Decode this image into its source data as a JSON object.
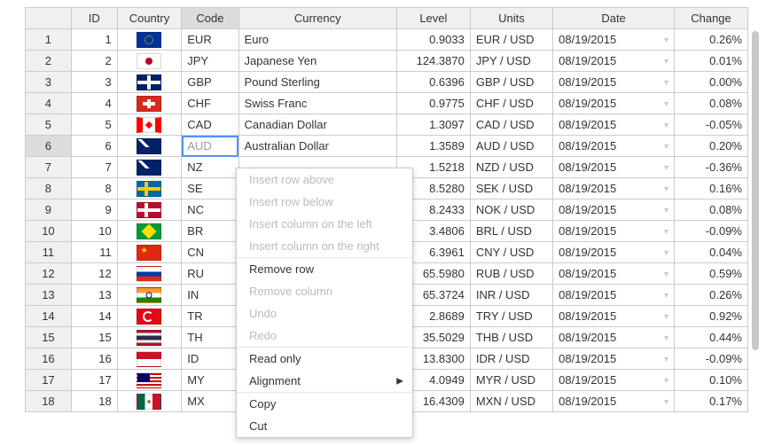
{
  "headers": {
    "id": "ID",
    "country": "Country",
    "code": "Code",
    "currency": "Currency",
    "level": "Level",
    "units": "Units",
    "date": "Date",
    "change": "Change"
  },
  "rows": [
    {
      "n": "1",
      "id": "1",
      "flag": "eu",
      "code": "EUR",
      "currency": "Euro",
      "level": "0.9033",
      "units": "EUR / USD",
      "date": "08/19/2015",
      "change": "0.26%"
    },
    {
      "n": "2",
      "id": "2",
      "flag": "jp",
      "code": "JPY",
      "currency": "Japanese Yen",
      "level": "124.3870",
      "units": "JPY / USD",
      "date": "08/19/2015",
      "change": "0.01%"
    },
    {
      "n": "3",
      "id": "3",
      "flag": "gb",
      "code": "GBP",
      "currency": "Pound Sterling",
      "level": "0.6396",
      "units": "GBP / USD",
      "date": "08/19/2015",
      "change": "0.00%"
    },
    {
      "n": "4",
      "id": "4",
      "flag": "ch",
      "code": "CHF",
      "currency": "Swiss Franc",
      "level": "0.9775",
      "units": "CHF / USD",
      "date": "08/19/2015",
      "change": "0.08%"
    },
    {
      "n": "5",
      "id": "5",
      "flag": "ca",
      "code": "CAD",
      "currency": "Canadian Dollar",
      "level": "1.3097",
      "units": "CAD / USD",
      "date": "08/19/2015",
      "change": "-0.05%"
    },
    {
      "n": "6",
      "id": "6",
      "flag": "au",
      "code": "AUD",
      "currency": "Australian Dollar",
      "level": "1.3589",
      "units": "AUD / USD",
      "date": "08/19/2015",
      "change": "0.20%"
    },
    {
      "n": "7",
      "id": "7",
      "flag": "nz",
      "code": "NZ",
      "currency": "",
      "level": "1.5218",
      "units": "NZD / USD",
      "date": "08/19/2015",
      "change": "-0.36%"
    },
    {
      "n": "8",
      "id": "8",
      "flag": "se",
      "code": "SE",
      "currency": "",
      "level": "8.5280",
      "units": "SEK / USD",
      "date": "08/19/2015",
      "change": "0.16%"
    },
    {
      "n": "9",
      "id": "9",
      "flag": "no",
      "code": "NC",
      "currency": "",
      "level": "8.2433",
      "units": "NOK / USD",
      "date": "08/19/2015",
      "change": "0.08%"
    },
    {
      "n": "10",
      "id": "10",
      "flag": "br",
      "code": "BR",
      "currency": "",
      "level": "3.4806",
      "units": "BRL / USD",
      "date": "08/19/2015",
      "change": "-0.09%"
    },
    {
      "n": "11",
      "id": "11",
      "flag": "cn",
      "code": "CN",
      "currency": "",
      "level": "6.3961",
      "units": "CNY / USD",
      "date": "08/19/2015",
      "change": "0.04%"
    },
    {
      "n": "12",
      "id": "12",
      "flag": "ru",
      "code": "RU",
      "currency": "",
      "level": "65.5980",
      "units": "RUB / USD",
      "date": "08/19/2015",
      "change": "0.59%"
    },
    {
      "n": "13",
      "id": "13",
      "flag": "in",
      "code": "IN",
      "currency": "",
      "level": "65.3724",
      "units": "INR / USD",
      "date": "08/19/2015",
      "change": "0.26%"
    },
    {
      "n": "14",
      "id": "14",
      "flag": "tr",
      "code": "TR",
      "currency": "",
      "level": "2.8689",
      "units": "TRY / USD",
      "date": "08/19/2015",
      "change": "0.92%"
    },
    {
      "n": "15",
      "id": "15",
      "flag": "th",
      "code": "TH",
      "currency": "",
      "level": "35.5029",
      "units": "THB / USD",
      "date": "08/19/2015",
      "change": "0.44%"
    },
    {
      "n": "16",
      "id": "16",
      "flag": "id",
      "code": "ID",
      "currency": "",
      "level": "13.8300",
      "units": "IDR / USD",
      "date": "08/19/2015",
      "change": "-0.09%"
    },
    {
      "n": "17",
      "id": "17",
      "flag": "my",
      "code": "MY",
      "currency": "",
      "level": "4.0949",
      "units": "MYR / USD",
      "date": "08/19/2015",
      "change": "0.10%"
    },
    {
      "n": "18",
      "id": "18",
      "flag": "mx",
      "code": "MX",
      "currency": "",
      "level": "16.4309",
      "units": "MXN / USD",
      "date": "08/19/2015",
      "change": "0.17%"
    }
  ],
  "active_row_index": 5,
  "context_menu": {
    "items": [
      {
        "label": "Insert row above",
        "disabled": true
      },
      {
        "label": "Insert row below",
        "disabled": true
      },
      {
        "label": "Insert column on the left",
        "disabled": true
      },
      {
        "label": "Insert column on the right",
        "disabled": true
      }
    ],
    "items2": [
      {
        "label": "Remove row",
        "disabled": false
      },
      {
        "label": "Remove column",
        "disabled": true
      },
      {
        "label": "Undo",
        "disabled": true
      },
      {
        "label": "Redo",
        "disabled": true
      }
    ],
    "items3": [
      {
        "label": "Read only",
        "disabled": false
      },
      {
        "label": "Alignment",
        "disabled": false,
        "submenu": true
      }
    ],
    "items4": [
      {
        "label": "Copy",
        "disabled": false
      },
      {
        "label": "Cut",
        "disabled": false
      }
    ]
  }
}
